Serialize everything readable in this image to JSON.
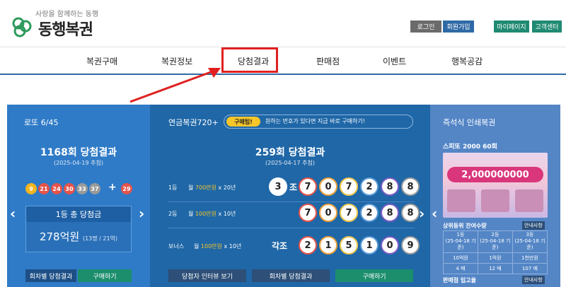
{
  "header": {
    "tagline": "사랑을 함께하는 동행",
    "logo_text": "동행복권",
    "util": [
      {
        "label": "로그인",
        "color": "#6b6b6b"
      },
      {
        "label": "회원가입",
        "color": "#2f6aa6"
      },
      {
        "label": "마이페이지",
        "color": "#1f8a72"
      },
      {
        "label": "고객센터",
        "color": "#1f8a72"
      }
    ]
  },
  "nav": {
    "items": [
      "복권구매",
      "복권정보",
      "당첨결과",
      "판매점",
      "이벤트",
      "행복공감"
    ]
  },
  "lotto": {
    "title": "로또 6/45",
    "round": "1168회 당첨결과",
    "date": "(2025-04-19 추첨)",
    "balls": [
      {
        "n": "9",
        "color": "#f2b51f"
      },
      {
        "n": "21",
        "color": "#e5534b"
      },
      {
        "n": "24",
        "color": "#e5534b"
      },
      {
        "n": "30",
        "color": "#e5534b"
      },
      {
        "n": "33",
        "color": "#9a9a9a"
      },
      {
        "n": "37",
        "color": "#9a9a9a"
      }
    ],
    "plus": "+",
    "bonus": {
      "n": "29",
      "color": "#e5534b"
    },
    "prize_label": "1등 총 당첨금",
    "prize_amount": "278억원",
    "prize_note": "(13명 / 21억)",
    "btn_history": "회차별 당첨결과",
    "btn_buy": "구매하기"
  },
  "pension": {
    "title": "연금복권720+",
    "tip_tag": "구매팁!",
    "tip_text": "원하는 번호가 있다면 지금 바로 구매하기!",
    "round": "259회 당첨결과",
    "date": "(2025-04-17 추첨)",
    "rows": [
      {
        "rank": "1등",
        "pre": "월 ",
        "amount": "700만원",
        "post": " x 20년",
        "group": "3",
        "group_suffix": "조",
        "digits": [
          "7",
          "0",
          "7",
          "2",
          "8",
          "8"
        ]
      },
      {
        "rank": "2등",
        "pre": "월 ",
        "amount": "100만원",
        "post": " x 10년",
        "group": "",
        "group_suffix": "",
        "digits": [
          "7",
          "0",
          "7",
          "2",
          "8",
          "8"
        ]
      },
      {
        "rank": "보너스",
        "pre": "월 ",
        "amount": "100만원",
        "post": " x 10년",
        "group": "",
        "group_suffix": "각조",
        "digits": [
          "2",
          "1",
          "5",
          "1",
          "0",
          "9"
        ]
      }
    ],
    "digit_colors": [
      "#e5534b",
      "#f2a23a",
      "#f2c94c",
      "#5c9bd6",
      "#7a5bc4",
      "#9a9a9a"
    ],
    "btn_interview": "당첨자 인터뷰 보기",
    "btn_history": "회차별 당첨결과",
    "btn_buy": "구매하기"
  },
  "instant": {
    "title": "즉석식 인쇄복권",
    "ticket_title": "스피또 2000 60회",
    "ticket_banner": "2,000000000",
    "remain_label": "상위등위 잔여수량",
    "guide": "안내사항",
    "cols": [
      {
        "rank": "1등",
        "date": "(25-04-18 기준)",
        "prize": "10억원",
        "remain": "4 매"
      },
      {
        "rank": "2등",
        "date": "(25-04-18 기준)",
        "prize": "1억원",
        "remain": "12 매"
      },
      {
        "rank": "3등",
        "date": "(25-04-18 기준)",
        "prize": "1천만원",
        "remain": "107 매"
      }
    ],
    "store_label": "판매점 입고율",
    "store_guide": "안내사항"
  }
}
